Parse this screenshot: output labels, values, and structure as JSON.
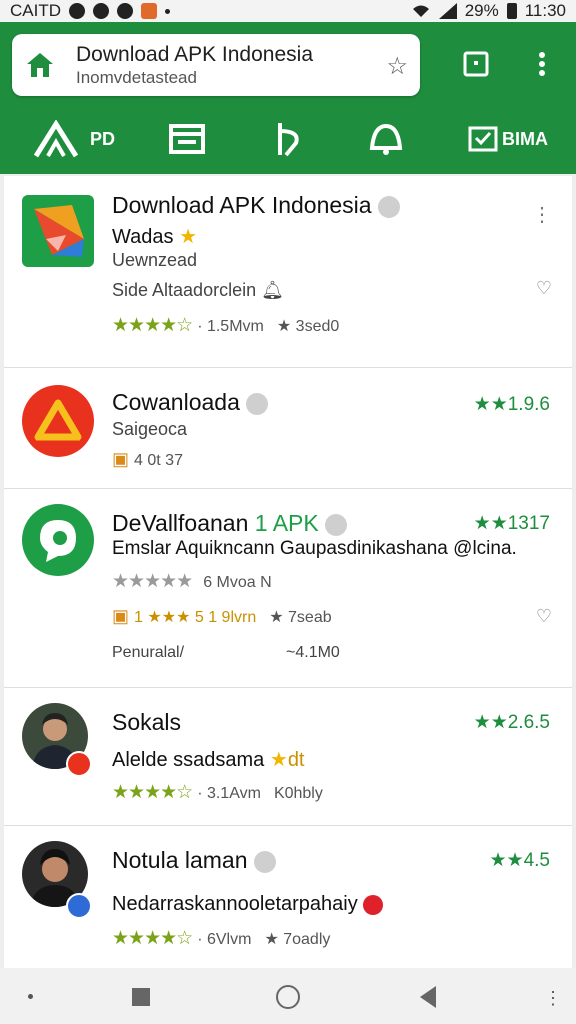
{
  "status_bar": {
    "carrier": "CAITD",
    "battery": "29%",
    "time": "11:30"
  },
  "header": {
    "title": "Download APK Indonesia",
    "subtitle": "Inomvdetastead",
    "nav": [
      {
        "label": "PD",
        "icon": "home-up-icon"
      },
      {
        "label": "",
        "icon": "stack-icon"
      },
      {
        "label": "",
        "icon": "share-arrow-icon"
      },
      {
        "label": "",
        "icon": "bell-icon"
      },
      {
        "label": "BIMA",
        "icon": "mail-check-icon"
      }
    ]
  },
  "apps": [
    {
      "title": "Download APK Indonesia",
      "tagline": "Wadas",
      "status": "Uewnzead",
      "detail": "Side Altaadorclein",
      "stars": "★★★★☆",
      "meta": "· 1.5Mvm",
      "meta2": "★ 3sed0"
    },
    {
      "title": "Cowanloada",
      "tagline": "Saigeoca",
      "meta": "4 0t 37",
      "rating": "★★1.9.6"
    },
    {
      "title": "DeVallfoanan",
      "title_tag": "1 APK",
      "description": "Emslar Aquikncann Gaupasdinikashana @lcina.",
      "stars": "★★★★★",
      "meta": "6 Mvoa N",
      "rank_line": "1 ★★★ 5 1 9lvrn",
      "meta2": "★ 7seab",
      "footer_left": "Penuralal/",
      "footer_right": "~4.1M0",
      "rating": "★★1317"
    },
    {
      "title": "Sokals",
      "tagline": "Alelde ssadsama",
      "tag_extra": "dt",
      "stars": "★★★★☆",
      "meta": "· 3.1Avm",
      "meta2": "K0hbly",
      "rating": "★★2.6.5"
    },
    {
      "title": "Notula laman",
      "tagline": "Nedarraskannooletarpahaiy",
      "stars": "★★★★☆",
      "meta": "· 6Vlvm",
      "meta2": "★ 7oadly",
      "rating": "★★4.5"
    }
  ],
  "colors": {
    "brand": "#1e8e3e",
    "star": "#7aa31a",
    "accent_yellow": "#f2b600"
  }
}
